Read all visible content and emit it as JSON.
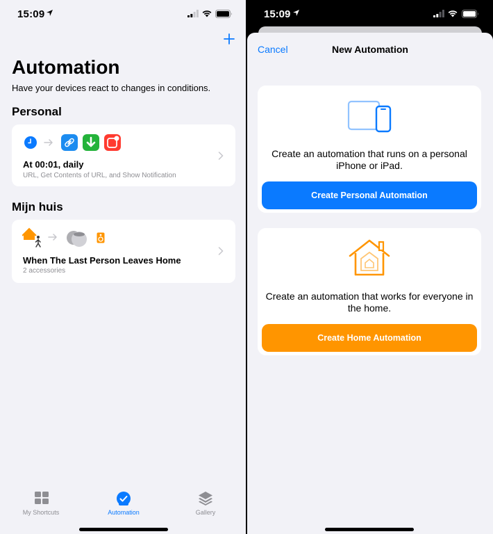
{
  "left": {
    "status_time": "15:09",
    "title": "Automation",
    "subtitle": "Have your devices react to changes in conditions.",
    "sections": [
      {
        "title": "Personal",
        "card": {
          "title": "At 00:01, daily",
          "subtitle": "URL, Get Contents of URL, and Show Notification",
          "icons": [
            "clock-icon",
            "link-icon",
            "download-icon",
            "notification-icon"
          ]
        }
      },
      {
        "title": "Mijn huis",
        "card": {
          "title": "When The Last Person Leaves Home",
          "subtitle": "2 accessories",
          "icons": [
            "home-person-icon",
            "homepod-icon",
            "speaker-icon"
          ]
        }
      }
    ],
    "tabs": [
      {
        "label": "My Shortcuts",
        "icon": "grid-icon",
        "active": false
      },
      {
        "label": "Automation",
        "icon": "automation-check-icon",
        "active": true
      },
      {
        "label": "Gallery",
        "icon": "layers-icon",
        "active": false
      }
    ]
  },
  "right": {
    "status_time": "15:09",
    "cancel_label": "Cancel",
    "title": "New Automation",
    "personal": {
      "description": "Create an automation that runs on a personal iPhone or iPad.",
      "button_label": "Create Personal Automation"
    },
    "home": {
      "description": "Create an automation that works for everyone in the home.",
      "button_label": "Create Home Automation"
    }
  },
  "colors": {
    "accent": "#0a7aff",
    "button_blue": "#0a7aff",
    "button_orange": "#ff9500",
    "background": "#f2f2f7",
    "tab_inactive": "#8e8e93"
  }
}
